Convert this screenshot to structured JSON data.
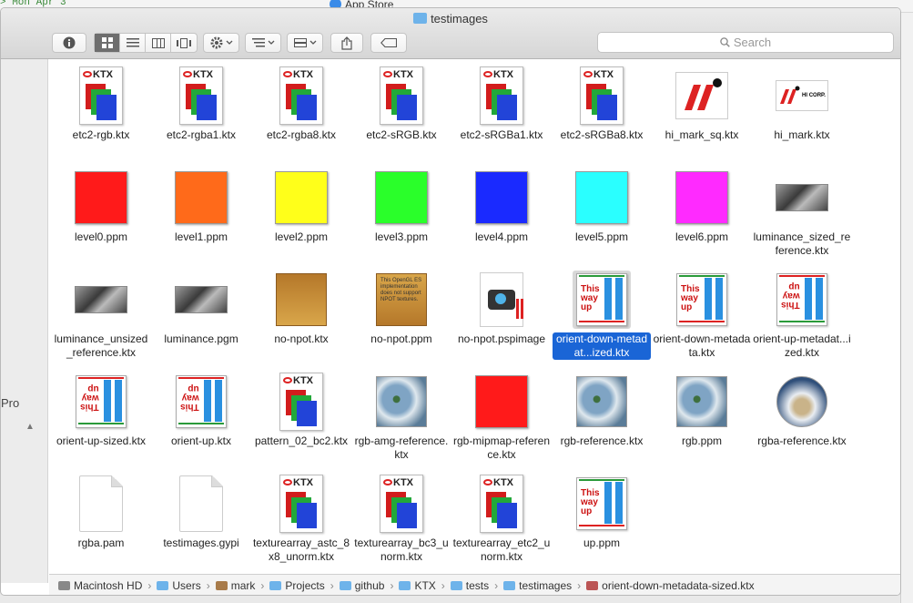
{
  "background": {
    "terminal_text": "> Mon Apr 3",
    "app_store": "App Store"
  },
  "window": {
    "title": "testimages"
  },
  "toolbar": {
    "search_placeholder": "Search"
  },
  "sidebar": {
    "partial_label": "Pro"
  },
  "files": [
    {
      "name": "etc2-rgb.ktx",
      "type": "ktx"
    },
    {
      "name": "etc2-rgba1.ktx",
      "type": "ktx"
    },
    {
      "name": "etc2-rgba8.ktx",
      "type": "ktx"
    },
    {
      "name": "etc2-sRGB.ktx",
      "type": "ktx"
    },
    {
      "name": "etc2-sRGBa1.ktx",
      "type": "ktx"
    },
    {
      "name": "etc2-sRGBa8.ktx",
      "type": "ktx"
    },
    {
      "name": "hi_mark_sq.ktx",
      "type": "himark"
    },
    {
      "name": "hi_mark.ktx",
      "type": "himark-wide",
      "text": "HI CORP."
    },
    {
      "name": "level0.ppm",
      "type": "color",
      "color": "#ff1a1a"
    },
    {
      "name": "level1.ppm",
      "type": "color",
      "color": "#ff6a1a"
    },
    {
      "name": "level2.ppm",
      "type": "color",
      "color": "#ffff1a"
    },
    {
      "name": "level3.ppm",
      "type": "color",
      "color": "#2aff2a"
    },
    {
      "name": "level4.ppm",
      "type": "color",
      "color": "#1a2aff"
    },
    {
      "name": "level5.ppm",
      "type": "color",
      "color": "#2affff"
    },
    {
      "name": "level6.ppm",
      "type": "color",
      "color": "#ff2aff"
    },
    {
      "name": "luminance_sized_reference.ktx",
      "type": "bw"
    },
    {
      "name": "luminance_unsized_reference.ktx",
      "type": "bw"
    },
    {
      "name": "luminance.pgm",
      "type": "bw"
    },
    {
      "name": "no-npot.ktx",
      "type": "npot-flip"
    },
    {
      "name": "no-npot.ppm",
      "type": "npot",
      "text": "This OpenGL ES implementation does not support NPOT textures."
    },
    {
      "name": "no-npot.pspimage",
      "type": "psp"
    },
    {
      "name": "orient-down-metadat...ized.ktx",
      "type": "orient-up",
      "selected": true
    },
    {
      "name": "orient-down-metadata.ktx",
      "type": "orient-up"
    },
    {
      "name": "orient-up-metadat...ized.ktx",
      "type": "orient-down"
    },
    {
      "name": "orient-up-sized.ktx",
      "type": "orient-down"
    },
    {
      "name": "orient-up.ktx",
      "type": "orient-down"
    },
    {
      "name": "pattern_02_bc2.ktx",
      "type": "ktx"
    },
    {
      "name": "rgb-amg-reference.ktx",
      "type": "photo"
    },
    {
      "name": "rgb-mipmap-reference.ktx",
      "type": "color",
      "color": "#ff1a1a"
    },
    {
      "name": "rgb-reference.ktx",
      "type": "photo"
    },
    {
      "name": "rgb.ppm",
      "type": "photo"
    },
    {
      "name": "rgba-reference.ktx",
      "type": "photo-round"
    },
    {
      "name": "rgba.pam",
      "type": "blank"
    },
    {
      "name": "testimages.gypi",
      "type": "blank"
    },
    {
      "name": "texturearray_astc_8x8_unorm.ktx",
      "type": "ktx"
    },
    {
      "name": "texturearray_bc3_unorm.ktx",
      "type": "ktx"
    },
    {
      "name": "texturearray_etc2_unorm.ktx",
      "type": "ktx"
    },
    {
      "name": "up.ppm",
      "type": "orient-up"
    }
  ],
  "icon_text": {
    "ktx": "KTX",
    "this_way_up": "This way up"
  },
  "pathbar": [
    {
      "label": "Macintosh HD",
      "icon": "hd-icon"
    },
    {
      "label": "Users",
      "icon": "folder-icon"
    },
    {
      "label": "mark",
      "icon": "home-icon"
    },
    {
      "label": "Projects",
      "icon": "folder-icon"
    },
    {
      "label": "github",
      "icon": "folder-icon"
    },
    {
      "label": "KTX",
      "icon": "folder-icon"
    },
    {
      "label": "tests",
      "icon": "folder-icon"
    },
    {
      "label": "testimages",
      "icon": "folder-icon"
    },
    {
      "label": "orient-down-metadata-sized.ktx",
      "icon": "file-icon"
    }
  ]
}
